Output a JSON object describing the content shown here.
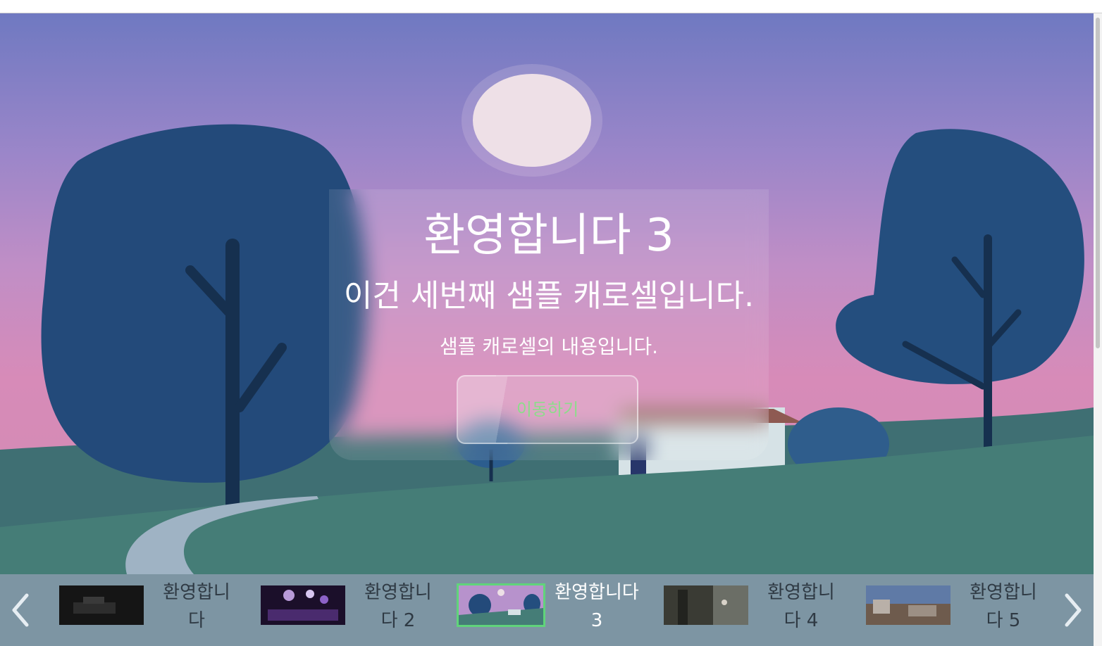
{
  "slide": {
    "title": "환영합니다 3",
    "subtitle": "이건 세번째 샘플 캐로셀입니다.",
    "body": "샘플 캐로셀의 내용입니다.",
    "button_label": "이동하기"
  },
  "thumbnails": [
    {
      "label": "환영합니다",
      "active": false
    },
    {
      "label": "환영합니다 2",
      "active": false
    },
    {
      "label": "환영합니다 3",
      "active": true
    },
    {
      "label": "환영합니다 4",
      "active": false
    },
    {
      "label": "환영합니다 5",
      "active": false
    }
  ],
  "icons": {
    "prev": "chevron-left-icon",
    "next": "chevron-right-icon"
  },
  "colors": {
    "button_text": "#8ddc8b",
    "active_thumb_border": "#60d47a",
    "thumb_bar": "#7d95a3"
  }
}
